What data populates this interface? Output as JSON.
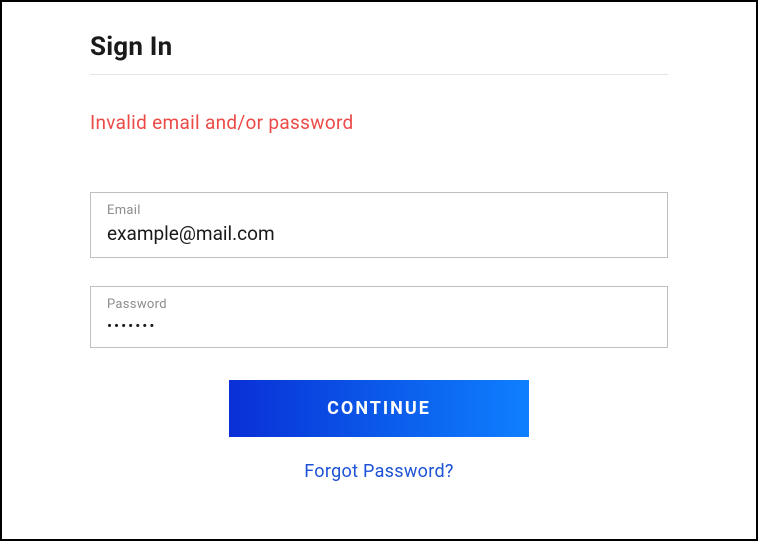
{
  "title": "Sign In",
  "error_message": "Invalid email and/or password",
  "fields": {
    "email": {
      "label": "Email",
      "value": "example@mail.com"
    },
    "password": {
      "label": "Password",
      "value": "•••••••"
    }
  },
  "buttons": {
    "continue": "CONTINUE",
    "forgot": "Forgot Password?"
  }
}
